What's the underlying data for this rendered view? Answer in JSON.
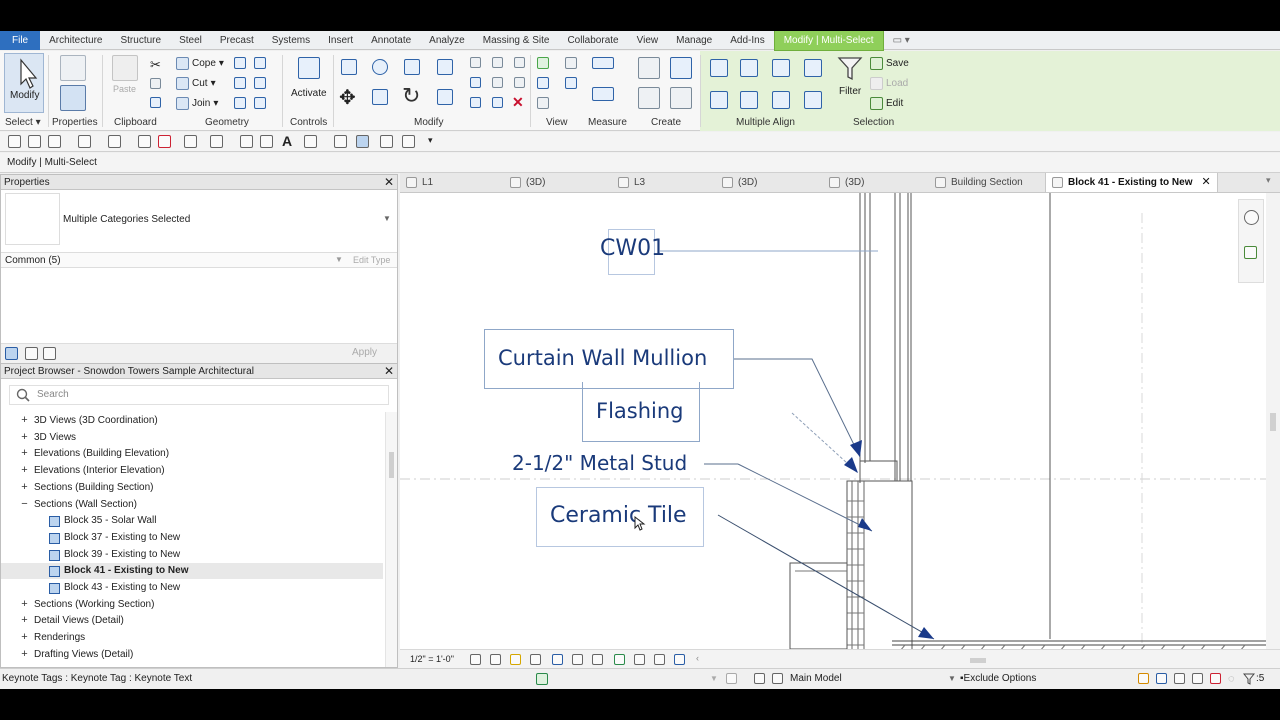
{
  "ribbon_tabs": [
    "File",
    "Architecture",
    "Structure",
    "Steel",
    "Precast",
    "Systems",
    "Insert",
    "Annotate",
    "Analyze",
    "Massing & Site",
    "Collaborate",
    "View",
    "Manage",
    "Add-Ins",
    "Modify | Multi-Select"
  ],
  "ribbon": {
    "modify": "Modify",
    "select": "Select",
    "properties": "Properties",
    "clipboard": "Clipboard",
    "paste": "Paste",
    "cope": "Cope",
    "cut": "Cut",
    "join": "Join",
    "geometry": "Geometry",
    "activate": "Activate",
    "controls": "Controls",
    "modify_panel": "Modify",
    "view": "View",
    "measure": "Measure",
    "create": "Create",
    "multiple_align": "Multiple Align",
    "filter": "Filter",
    "save": "Save",
    "load": "Load",
    "edit": "Edit",
    "selection": "Selection"
  },
  "options_bar": "Modify | Multi-Select",
  "properties": {
    "title": "Properties",
    "type": "Multiple Categories Selected",
    "filter": "Common (5)",
    "edit_type": "Edit Type",
    "apply": "Apply"
  },
  "browser": {
    "title": "Project Browser - Snowdon Towers Sample Architectural",
    "search_placeholder": "Search",
    "items": [
      {
        "label": "3D Views (3D Coordination)",
        "level": 0,
        "expander": "+"
      },
      {
        "label": "3D Views",
        "level": 0,
        "expander": "+"
      },
      {
        "label": "Elevations (Building Elevation)",
        "level": 0,
        "expander": "+"
      },
      {
        "label": "Elevations (Interior Elevation)",
        "level": 0,
        "expander": "+"
      },
      {
        "label": "Sections (Building Section)",
        "level": 0,
        "expander": "+"
      },
      {
        "label": "Sections (Wall Section)",
        "level": 0,
        "expander": "−"
      },
      {
        "label": "Block 35 - Solar Wall",
        "level": 1
      },
      {
        "label": "Block 37 - Existing to New",
        "level": 1
      },
      {
        "label": "Block 39 - Existing to New",
        "level": 1
      },
      {
        "label": "Block 41 - Existing to New",
        "level": 1,
        "selected": true
      },
      {
        "label": "Block 43 - Existing to New",
        "level": 1
      },
      {
        "label": "Sections (Working Section)",
        "level": 0,
        "expander": "+"
      },
      {
        "label": "Detail Views (Detail)",
        "level": 0,
        "expander": "+"
      },
      {
        "label": "Renderings",
        "level": 0,
        "expander": "+"
      },
      {
        "label": "Drafting Views (Detail)",
        "level": 0,
        "expander": "+"
      }
    ]
  },
  "view_tabs": [
    "L1",
    "(3D)",
    "L3",
    "(3D)",
    "(3D)",
    "Building Section",
    "Block 41 - Existing to New"
  ],
  "annotations": {
    "cw01": "CW01",
    "mullion": "Curtain Wall Mullion",
    "flashing": "Flashing",
    "stud": "2-1/2\" Metal Stud",
    "tile": "Ceramic Tile"
  },
  "view_scale": "1/2\" = 1'-0\"",
  "status": {
    "hint": "Keynote Tags : Keynote Tag : Keynote Text",
    "model": "Main Model",
    "exclude": "Exclude Options",
    "filter_count": ":5"
  },
  "colors": {
    "accent": "#2e6fbf",
    "contextual_tab": "#8fcf5a",
    "annotation_text": "#1a3a7a"
  }
}
